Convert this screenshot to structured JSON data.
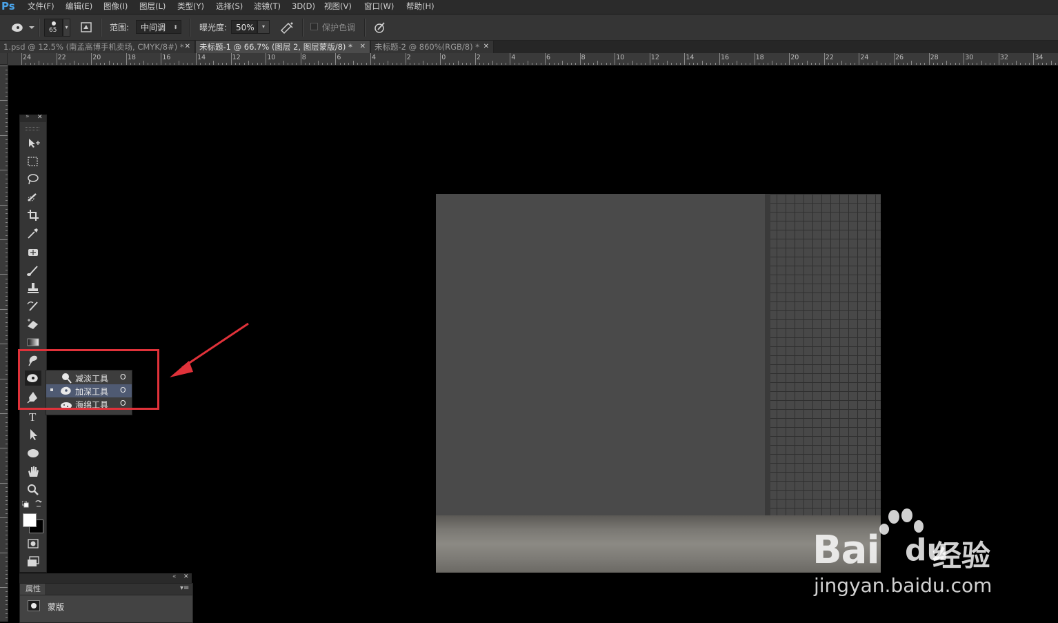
{
  "app": {
    "logo": "Ps"
  },
  "menu": [
    "文件(F)",
    "编辑(E)",
    "图像(I)",
    "图层(L)",
    "类型(Y)",
    "选择(S)",
    "滤镜(T)",
    "3D(D)",
    "视图(V)",
    "窗口(W)",
    "帮助(H)"
  ],
  "options": {
    "tool_icon": "burn-tool-icon",
    "brush_size": "65",
    "range_label": "范围:",
    "range_value": "中间调",
    "exposure_label": "曝光度:",
    "exposure_value": "50%",
    "protect_tones_label": "保护色调",
    "protect_tones_checked": false
  },
  "tabs": [
    {
      "title": "1.psd @ 12.5% (南孟高博手机卖场, CMYK/8#) *",
      "active": false
    },
    {
      "title": "未标题-1 @ 66.7% (图层 2, 图层蒙版/8) *",
      "active": true
    },
    {
      "title": "未标题-2 @ 860%(RGB/8) *",
      "active": false
    }
  ],
  "ruler": {
    "h_labels": [
      "24",
      "22",
      "20",
      "18",
      "16",
      "14",
      "12",
      "10",
      "8",
      "6",
      "4",
      "2",
      "0",
      "2",
      "4",
      "6",
      "8",
      "10",
      "12",
      "14",
      "16",
      "18",
      "20",
      "22",
      "24",
      "26",
      "28",
      "30",
      "32",
      "34"
    ]
  },
  "toolbar": {
    "tools": [
      "move-tool",
      "marquee-tool",
      "lasso-tool",
      "quick-select-tool",
      "crop-tool",
      "eyedropper-tool",
      "healing-brush-tool",
      "brush-tool",
      "clone-stamp-tool",
      "history-brush-tool",
      "eraser-tool",
      "gradient-tool",
      "blur-tool",
      "burn-tool",
      "pen-tool",
      "type-tool",
      "path-select-tool",
      "ellipse-tool",
      "hand-tool",
      "zoom-tool"
    ],
    "foreground_color": "#ffffff",
    "background_color": "#000000"
  },
  "flyout": {
    "items": [
      {
        "label": "减淡工具",
        "key": "O",
        "icon": "dodge-tool-icon",
        "selected": false
      },
      {
        "label": "加深工具",
        "key": "O",
        "icon": "burn-tool-icon",
        "selected": true
      },
      {
        "label": "海绵工具",
        "key": "O",
        "icon": "sponge-tool-icon",
        "selected": false
      }
    ]
  },
  "properties_panel": {
    "tab_label": "属性",
    "row_label": "蒙版"
  },
  "colors": {
    "highlight": "#e0323a",
    "canvas_gray": "#4a4a4a",
    "logo_blue": "#4aa3e8"
  },
  "watermark": {
    "brand": "Bai",
    "du": "du",
    "suffix": "经验",
    "url": "jingyan.baidu.com"
  }
}
